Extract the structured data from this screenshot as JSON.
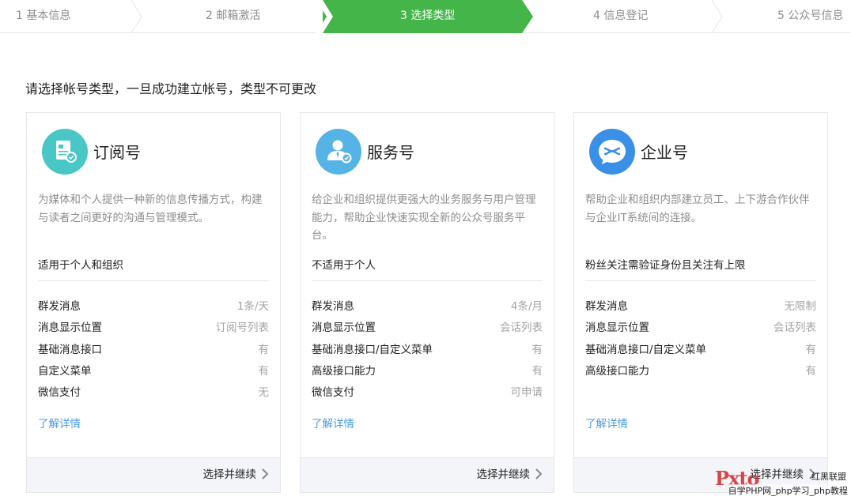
{
  "steps": [
    {
      "label": "1 基本信息",
      "active": false
    },
    {
      "label": "2 邮箱激活",
      "active": false
    },
    {
      "label": "3 选择类型",
      "active": true
    },
    {
      "label": "4 信息登记",
      "active": false
    },
    {
      "label": "5 公众号信息",
      "active": false
    }
  ],
  "colors": {
    "accent_green": "#44b549",
    "link_blue": "#459ae9",
    "icon_teal": "#49c6c6",
    "icon_sky": "#56b3e6",
    "icon_blue": "#3a8fe6"
  },
  "intro": "请选择帐号类型，一旦成功建立帐号，类型不可更改",
  "cards": [
    {
      "icon": "subscription-icon",
      "title": "订阅号",
      "desc": "为媒体和个人提供一种新的信息传播方式，构建与读者之间更好的沟通与管理模式。",
      "suit": "适用于个人和组织",
      "features": [
        {
          "k": "群发消息",
          "v": "1条/天"
        },
        {
          "k": "消息显示位置",
          "v": "订阅号列表"
        },
        {
          "k": "基础消息接口",
          "v": "有"
        },
        {
          "k": "自定义菜单",
          "v": "有"
        },
        {
          "k": "微信支付",
          "v": "无"
        }
      ],
      "more": "了解详情",
      "button": "选择并继续"
    },
    {
      "icon": "service-account-icon",
      "title": "服务号",
      "desc": "给企业和组织提供更强大的业务服务与用户管理能力，帮助企业快速实现全新的公众号服务平台。",
      "suit": "不适用于个人",
      "features": [
        {
          "k": "群发消息",
          "v": "4条/月"
        },
        {
          "k": "消息显示位置",
          "v": "会话列表"
        },
        {
          "k": "基础消息接口/自定义菜单",
          "v": "有"
        },
        {
          "k": "高级接口能力",
          "v": "有"
        },
        {
          "k": "微信支付",
          "v": "可申请"
        }
      ],
      "more": "了解详情",
      "button": "选择并继续"
    },
    {
      "icon": "enterprise-icon",
      "title": "企业号",
      "desc": "帮助企业和组织内部建立员工、上下游合作伙伴与企业IT系统间的连接。",
      "suit": "粉丝关注需验证身份且关注有上限",
      "features": [
        {
          "k": "群发消息",
          "v": "无限制"
        },
        {
          "k": "消息显示位置",
          "v": "会话列表"
        },
        {
          "k": "基础消息接口/自定义菜单",
          "v": "有"
        },
        {
          "k": "高级接口能力",
          "v": "有"
        }
      ],
      "more": "了解详情",
      "button": "选择并继续"
    }
  ],
  "watermark": {
    "logo": "Pxto",
    "line1": "红黑联盟",
    "line2": "自学PHP网_php学习_php教程"
  }
}
